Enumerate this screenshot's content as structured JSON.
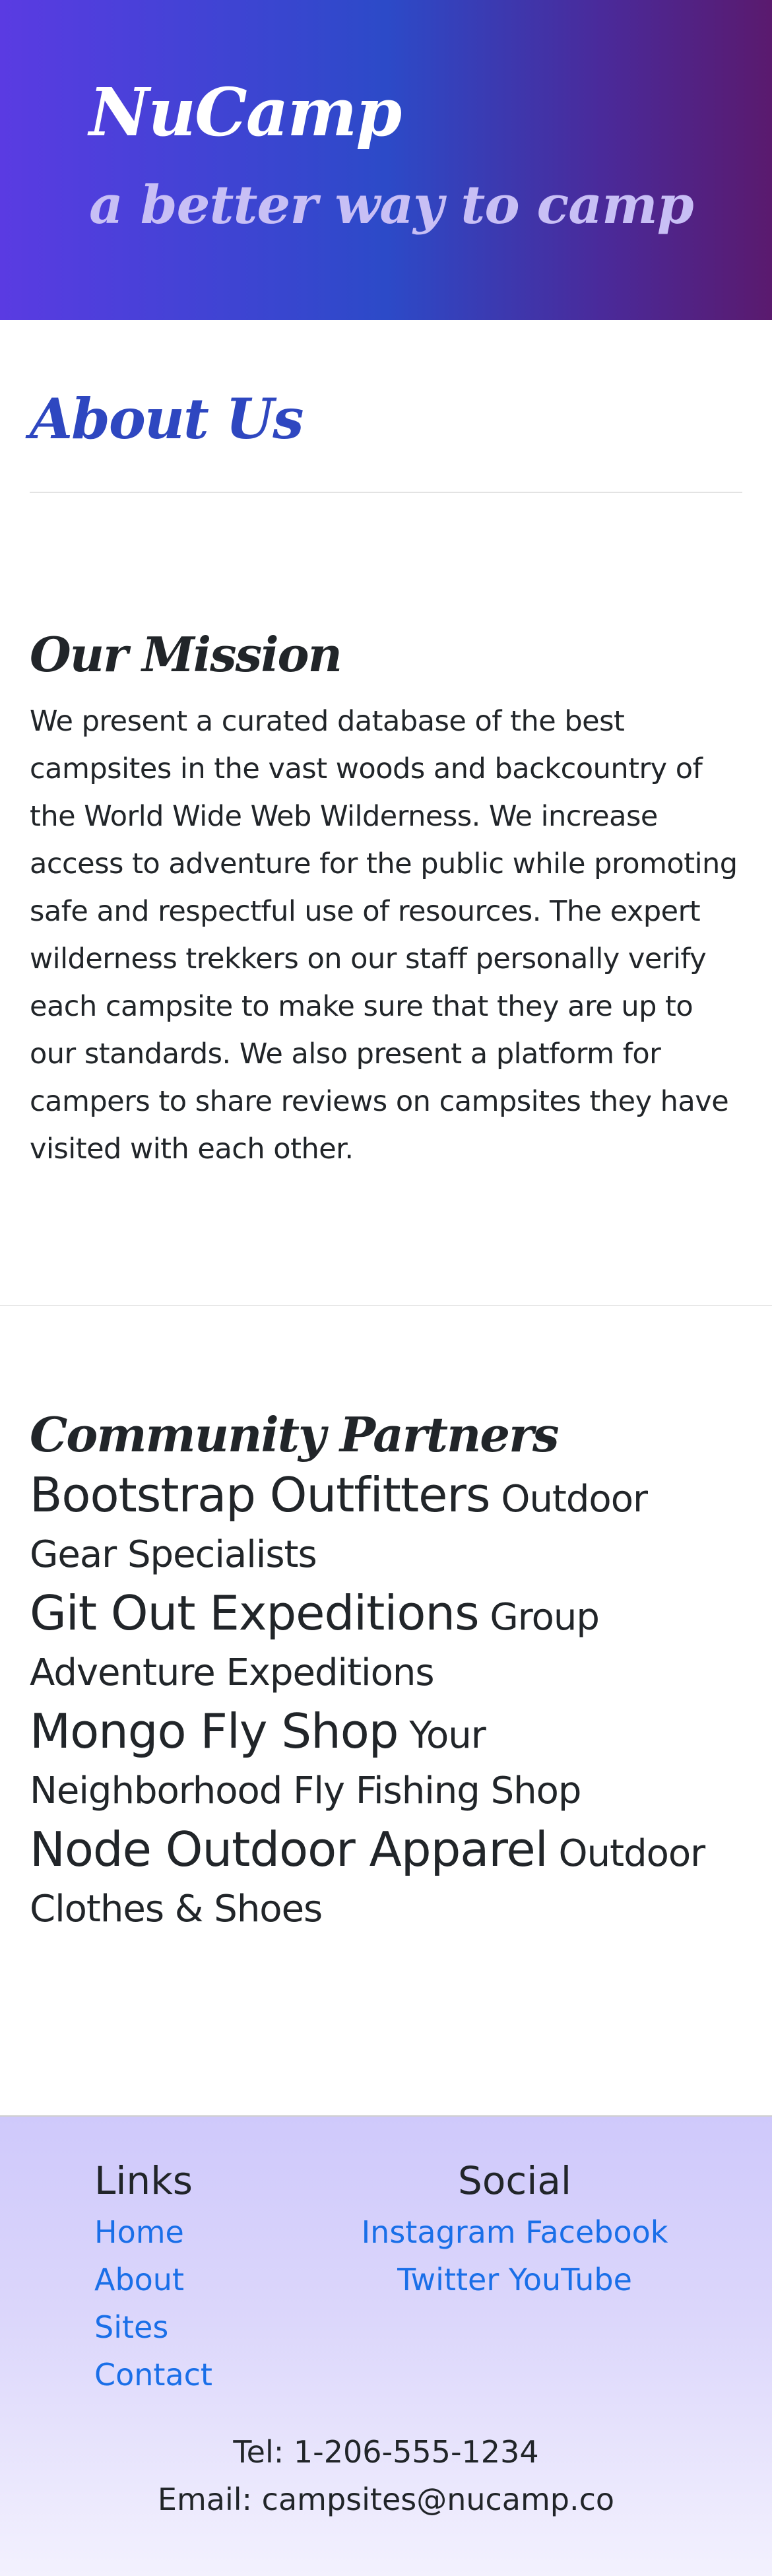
{
  "header": {
    "brand": "NuCamp",
    "tagline": "a better way to camp"
  },
  "about": {
    "title": "About Us"
  },
  "mission": {
    "title": "Our Mission",
    "text": "We present a curated database of the best campsites in the vast woods and backcountry of the World Wide Web Wilderness. We increase access to adventure for the public while promoting safe and respectful use of resources. The expert wilderness trekkers on our staff personally verify each campsite to make sure that they are up to our standards. We also present a platform for campers to share reviews on campsites they have visited with each other."
  },
  "partners": {
    "title": "Community Partners",
    "items": [
      {
        "name": "Bootstrap Outfitters",
        "desc": "Outdoor Gear Specialists"
      },
      {
        "name": "Git Out Expeditions",
        "desc": "Group Adventure Expeditions"
      },
      {
        "name": "Mongo Fly Shop",
        "desc": "Your Neighborhood Fly Fishing Shop"
      },
      {
        "name": "Node Outdoor Apparel",
        "desc": "Outdoor Clothes & Shoes"
      }
    ]
  },
  "footer": {
    "links_heading": "Links",
    "links": [
      "Home",
      "About",
      "Sites",
      "Contact"
    ],
    "social_heading": "Social",
    "social": [
      "Instagram",
      "Facebook",
      "Twitter",
      "YouTube"
    ],
    "tel": "Tel: 1-206-555-1234",
    "email_label": "Email: ",
    "email": "campsites@nucamp.co"
  },
  "colors": {
    "brand_blue": "#2e47c0",
    "link_blue": "#1a6fe8",
    "header_gradient_start": "#5a3be2",
    "header_gradient_end": "#5a1a6e",
    "footer_bg": "#cfc9fb"
  }
}
